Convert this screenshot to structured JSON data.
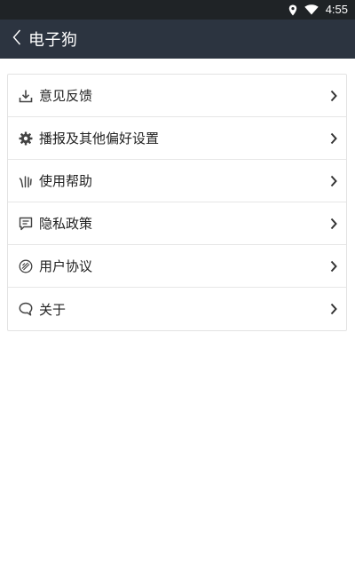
{
  "status_bar": {
    "time": "4:55",
    "icons": [
      "location-icon",
      "wifi-icon"
    ]
  },
  "app_bar": {
    "title": "电子狗",
    "back_icon": "chevron-left-icon"
  },
  "colors": {
    "status_bar_bg": "#1f2326",
    "app_bar_bg": "#2c3440",
    "text": "#222222",
    "icon": "#444444",
    "divider": "#e6e6e6"
  },
  "menu": {
    "items": [
      {
        "label": "意见反馈",
        "icon": "download-icon"
      },
      {
        "label": "播报及其他偏好设置",
        "icon": "gear-icon"
      },
      {
        "label": "使用帮助",
        "icon": "help-hand-icon"
      },
      {
        "label": "隐私政策",
        "icon": "message-icon"
      },
      {
        "label": "用户协议",
        "icon": "agreement-icon"
      },
      {
        "label": "关于",
        "icon": "chat-bubble-icon"
      }
    ]
  }
}
